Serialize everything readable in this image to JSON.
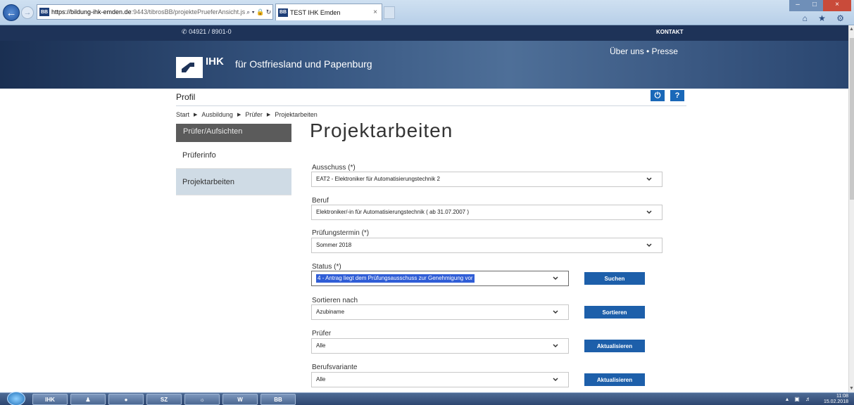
{
  "browser": {
    "url_host": "https://bildung-ihk-emden.de",
    "url_rest": ":9443/tibrosBB/projektePrueferAnsicht.js",
    "addr_icons": "⌕ ▾ 🔒 ↻",
    "favicon": "BB",
    "tab_title": "TEST IHK Emden",
    "tab_close": "×",
    "toolbar_icons": "⌂ ★ ⚙"
  },
  "site": {
    "phone": "04921 / 8901-0",
    "phone_icon": "phone-icon",
    "kontakt": "KONTAKT",
    "logo_ihk": "IHK",
    "logo_sub": "für Ostfriesland und Papenburg",
    "topnav": "Über uns • Presse"
  },
  "profil": {
    "label": "Profil",
    "power_icon": "⏻",
    "help": "?"
  },
  "breadcrumb": [
    "Start",
    "Ausbildung",
    "Prüfer",
    "Projektarbeiten"
  ],
  "breadcrumb_sep": "▶",
  "sidebar": {
    "header": "Prüfer/Aufsichten",
    "items": [
      {
        "label": "Prüferinfo"
      },
      {
        "label": "Projektarbeiten"
      }
    ]
  },
  "main": {
    "title": "Projektarbeiten",
    "fields": {
      "ausschuss": {
        "label": "Ausschuss (*)",
        "value": "EAT2 - Elektroniker für Automatisierungstechnik 2"
      },
      "beruf": {
        "label": "Beruf",
        "value": "Elektroniker/-in für Automatisierungstechnik ( ab 31.07.2007 )"
      },
      "pruefungstermin": {
        "label": "Prüfungstermin (*)",
        "value": "Sommer 2018"
      },
      "status": {
        "label": "Status (*)",
        "value": "4 - Antrag liegt dem Prüfungsausschuss zur Genehmigung vor",
        "button": "Suchen"
      },
      "sortieren": {
        "label": "Sortieren nach",
        "value": "Azubiname",
        "button": "Sortieren"
      },
      "pruefer": {
        "label": "Prüfer",
        "value": "Alle",
        "button": "Aktualisieren"
      },
      "berufsvariante": {
        "label": "Berufsvariante",
        "value": "Alle",
        "button": "Aktualisieren"
      }
    }
  },
  "taskbar": {
    "items": [
      "IHK",
      "",
      "",
      "SZ",
      "",
      "W",
      "BB"
    ],
    "clock_time": "11:08",
    "clock_date": "15.02.2018"
  },
  "colors": {
    "topbar": "#1e3358",
    "button": "#1d5faa",
    "sidebar_active": "#cfdbe5",
    "sidebar_header": "#5b5b5b"
  }
}
